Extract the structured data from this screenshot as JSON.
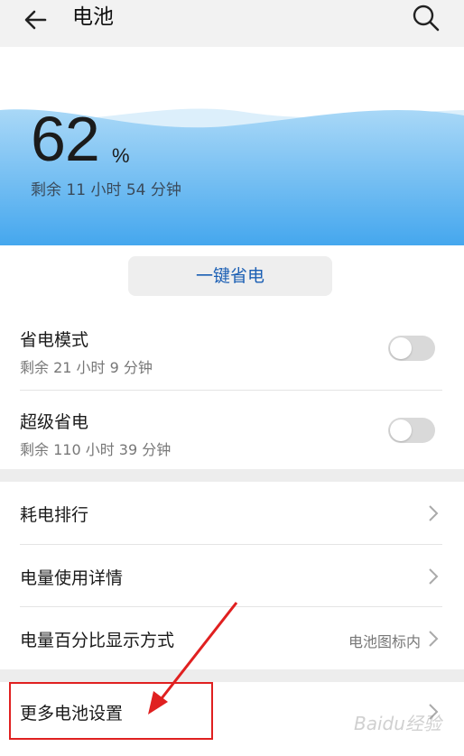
{
  "header": {
    "title": "电池",
    "back_icon": "back-arrow-icon",
    "search_icon": "search-icon"
  },
  "battery": {
    "percent": "62",
    "percent_sign": "%",
    "remaining": "剩余 11 小时 54 分钟",
    "level": 0.62,
    "colors": {
      "wave_top": "#bfe3f8",
      "wave_bottom": "#3aa0ea"
    }
  },
  "one_key_save": {
    "label": "一键省电",
    "color": "#1b5fb4"
  },
  "modes": [
    {
      "title": "省电模式",
      "subtitle": "剩余 21 小时 9 分钟",
      "enabled": false
    },
    {
      "title": "超级省电",
      "subtitle": "剩余 110 小时 39 分钟",
      "enabled": false
    }
  ],
  "menu": [
    {
      "label": "耗电排行",
      "value": ""
    },
    {
      "label": "电量使用详情",
      "value": ""
    },
    {
      "label": "电量百分比显示方式",
      "value": "电池图标内"
    }
  ],
  "more": {
    "label": "更多电池设置"
  },
  "watermark": "Baidu经验",
  "annotation_color": "#e02020"
}
